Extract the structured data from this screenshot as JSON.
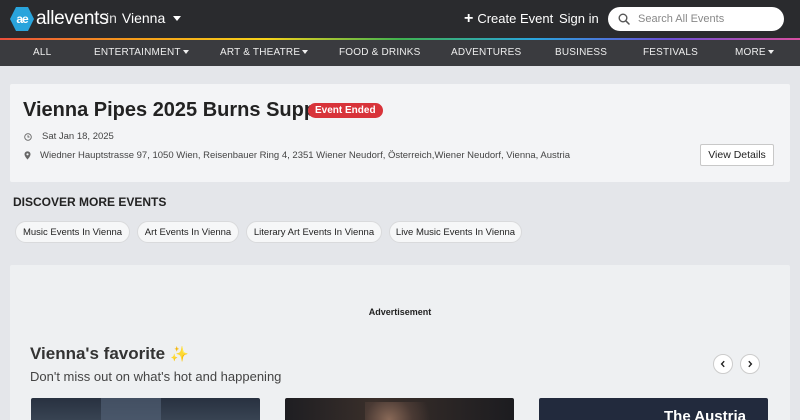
{
  "header": {
    "logo_text": "allevents",
    "logo_mark": "ae",
    "city_prefix": "in",
    "city": "Vienna",
    "create_event_label": "Create Event",
    "sign_in_label": "Sign in",
    "search_placeholder": "Search All Events"
  },
  "categories": [
    {
      "label": "ALL",
      "has_menu": false
    },
    {
      "label": "ENTERTAINMENT",
      "has_menu": true
    },
    {
      "label": "ART & THEATRE",
      "has_menu": true
    },
    {
      "label": "FOOD & DRINKS",
      "has_menu": false
    },
    {
      "label": "ADVENTURES",
      "has_menu": false
    },
    {
      "label": "BUSINESS",
      "has_menu": false
    },
    {
      "label": "FESTIVALS",
      "has_menu": false
    },
    {
      "label": "MORE",
      "has_menu": true
    }
  ],
  "event": {
    "title": "Vienna Pipes 2025 Burns Supper",
    "status_badge": "Event Ended",
    "date": "Sat Jan 18, 2025",
    "location": "Wiedner Hauptstrasse 97, 1050 Wien, Reisenbauer Ring 4, 2351 Wiener Neudorf, Österreich,Wiener Neudorf, Vienna, Austria",
    "view_details_label": "View Details",
    "badge_color": "#d8333a"
  },
  "discover": {
    "title": "DISCOVER MORE EVENTS",
    "chips": [
      "Music Events In Vienna",
      "Art Events In Vienna",
      "Literary Art Events In Vienna",
      "Live Music Events In Vienna"
    ]
  },
  "favorites": {
    "ad_label": "Advertisement",
    "title": "Vienna's favorite",
    "subtitle": "Don't miss out on what's hot and happening",
    "card3_text": "The Austria"
  },
  "colors": {
    "header_bg": "#2a2b2e",
    "nav_bg": "#3a3b3f",
    "brand": "#29a4dc"
  }
}
